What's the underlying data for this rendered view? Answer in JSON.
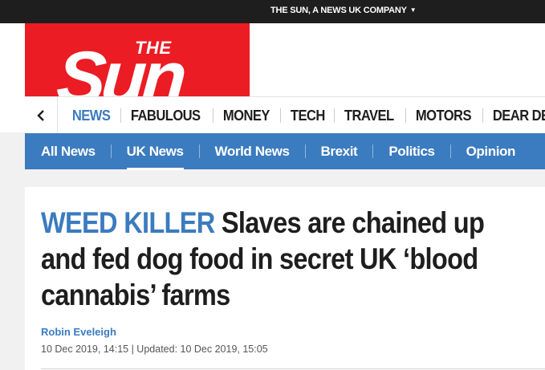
{
  "topbar": {
    "company_label": "THE SUN, A NEWS UK COMPANY",
    "chevron_icon": "chevron-down-icon"
  },
  "logo": {
    "the": "THE",
    "sun": "Sun",
    "background": "#eb1c24"
  },
  "main_nav": {
    "back_icon": "chevron-left-icon",
    "items": [
      {
        "label": "NEWS",
        "active": true
      },
      {
        "label": "FABULOUS"
      },
      {
        "label": "MONEY"
      },
      {
        "label": "TECH"
      },
      {
        "label": "TRAVEL"
      },
      {
        "label": "MOTORS"
      },
      {
        "label": "DEAR DE"
      }
    ]
  },
  "sub_nav": {
    "background": "#3b7bbf",
    "items": [
      {
        "label": "All News"
      },
      {
        "label": "UK News",
        "active": true
      },
      {
        "label": "World News"
      },
      {
        "label": "Brexit"
      },
      {
        "label": "Politics"
      },
      {
        "label": "Opinion"
      }
    ]
  },
  "article": {
    "kicker": "WEED KILLER",
    "headline": "Slaves are chained up and fed dog food in secret UK ‘blood cannabis’ farms",
    "author": "Robin Eveleigh",
    "dateline": "10 Dec 2019, 14:15 | Updated: 10 Dec 2019, 15:05"
  },
  "colors": {
    "accent": "#3b7bbf",
    "topbar": "#1e1e1e",
    "text": "#1e1e1e"
  }
}
